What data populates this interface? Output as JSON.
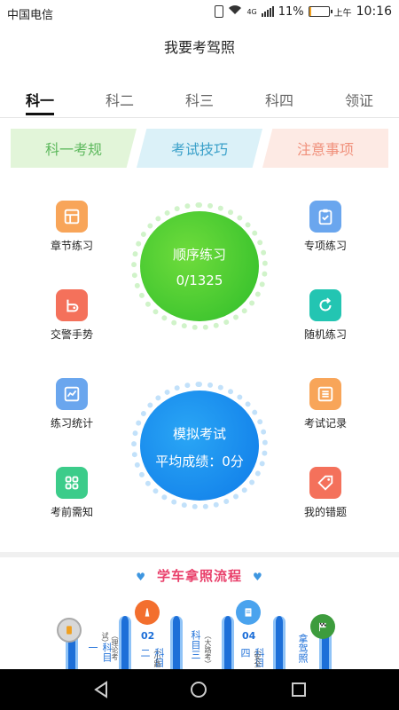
{
  "status_bar": {
    "carrier": "中国电信",
    "network": "4G",
    "battery": "11%",
    "battery_level": 0.11,
    "ampm": "上午",
    "time": "10:16"
  },
  "header": {
    "title": "我要考驾照"
  },
  "tabs": [
    {
      "label": "科一",
      "active": true
    },
    {
      "label": "科二",
      "active": false
    },
    {
      "label": "科三",
      "active": false
    },
    {
      "label": "科四",
      "active": false
    },
    {
      "label": "领证",
      "active": false
    }
  ],
  "ribbons": [
    {
      "label": "科一考规",
      "color": "#5cb85c"
    },
    {
      "label": "考试技巧",
      "color": "#3aa0c9"
    },
    {
      "label": "注意事项",
      "color": "#f0907b"
    }
  ],
  "features": {
    "chapter": {
      "label": "章节练习",
      "icon": "layout-icon"
    },
    "special": {
      "label": "专项练习",
      "icon": "clipboard-check-icon"
    },
    "police": {
      "label": "交警手势",
      "icon": "traffic-icon"
    },
    "random": {
      "label": "随机练习",
      "icon": "refresh-icon"
    },
    "stats": {
      "label": "练习统计",
      "icon": "chart-line-icon"
    },
    "records": {
      "label": "考试记录",
      "icon": "list-icon"
    },
    "notice": {
      "label": "考前需知",
      "icon": "grid-icon"
    },
    "mistakes": {
      "label": "我的错题",
      "icon": "tag-icon"
    }
  },
  "sequence": {
    "label": "顺序练习",
    "progress": "0/1325"
  },
  "exam": {
    "label": "模拟考试",
    "score": "平均成绩：0分"
  },
  "process": {
    "title": "学车拿照流程",
    "steps": [
      {
        "num": "02",
        "text": "科目一",
        "sub": "（理论考试）"
      },
      {
        "num": "",
        "text": "科目二",
        "sub": "（小路"
      },
      {
        "num": "04",
        "text": "科目三",
        "sub": "（大路考）"
      },
      {
        "num": "",
        "text": "科目四",
        "sub": "（安全"
      },
      {
        "num": "",
        "text": "拿驾照",
        "sub": ""
      }
    ]
  }
}
